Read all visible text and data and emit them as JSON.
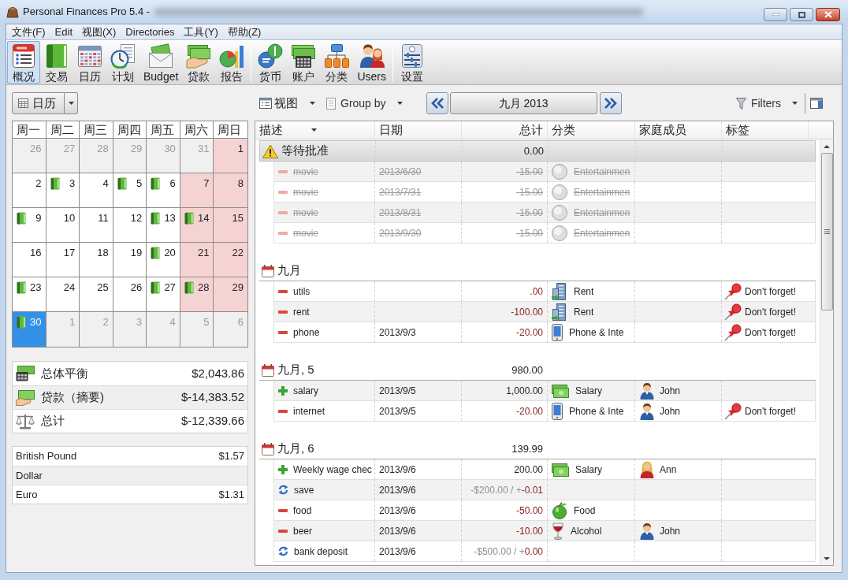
{
  "window": {
    "title": "Personal Finances Pro 5.4 -"
  },
  "menu": [
    "文件(F)",
    "Edit",
    "视图(X)",
    "Directories",
    "工具(Y)",
    "帮助(Z)"
  ],
  "toolbar": {
    "groups": [
      [
        {
          "label": "概况",
          "selected": true
        },
        {
          "label": "交易",
          "selected": false
        },
        {
          "label": "日历",
          "selected": false
        },
        {
          "label": "计划",
          "selected": false
        },
        {
          "label": "Budget",
          "selected": false
        },
        {
          "label": "贷款",
          "selected": false
        },
        {
          "label": "报告",
          "selected": false
        }
      ],
      [
        {
          "label": "货币",
          "selected": false
        },
        {
          "label": "账户",
          "selected": false
        },
        {
          "label": "分类",
          "selected": false
        },
        {
          "label": "Users",
          "selected": false
        }
      ],
      [
        {
          "label": "设置",
          "selected": false
        }
      ]
    ]
  },
  "left": {
    "view_selector": "日历",
    "calendar": {
      "weekdays": [
        "周一",
        "周二",
        "周三",
        "周四",
        "周五",
        "周六",
        "周日"
      ],
      "weeks": [
        [
          {
            "day": "26",
            "other_month": true,
            "has_entry": false,
            "selected": false
          },
          {
            "day": "27",
            "other_month": true,
            "has_entry": false,
            "selected": false
          },
          {
            "day": "28",
            "other_month": true,
            "has_entry": false,
            "selected": false
          },
          {
            "day": "29",
            "other_month": true,
            "has_entry": false,
            "selected": false
          },
          {
            "day": "30",
            "other_month": true,
            "has_entry": false,
            "selected": false
          },
          {
            "day": "31",
            "other_month": true,
            "has_entry": false,
            "selected": false
          },
          {
            "day": "1",
            "other_month": false,
            "has_entry": false,
            "selected": false
          }
        ],
        [
          {
            "day": "2",
            "other_month": false,
            "has_entry": false,
            "selected": false
          },
          {
            "day": "3",
            "other_month": false,
            "has_entry": true,
            "selected": false
          },
          {
            "day": "4",
            "other_month": false,
            "has_entry": false,
            "selected": false
          },
          {
            "day": "5",
            "other_month": false,
            "has_entry": true,
            "selected": false
          },
          {
            "day": "6",
            "other_month": false,
            "has_entry": true,
            "selected": false
          },
          {
            "day": "7",
            "other_month": false,
            "has_entry": false,
            "selected": false
          },
          {
            "day": "8",
            "other_month": false,
            "has_entry": false,
            "selected": false
          }
        ],
        [
          {
            "day": "9",
            "other_month": false,
            "has_entry": true,
            "selected": false
          },
          {
            "day": "10",
            "other_month": false,
            "has_entry": false,
            "selected": false
          },
          {
            "day": "11",
            "other_month": false,
            "has_entry": false,
            "selected": false
          },
          {
            "day": "12",
            "other_month": false,
            "has_entry": false,
            "selected": false
          },
          {
            "day": "13",
            "other_month": false,
            "has_entry": true,
            "selected": false
          },
          {
            "day": "14",
            "other_month": false,
            "has_entry": true,
            "selected": false
          },
          {
            "day": "15",
            "other_month": false,
            "has_entry": false,
            "selected": false
          }
        ],
        [
          {
            "day": "16",
            "other_month": false,
            "has_entry": false,
            "selected": false
          },
          {
            "day": "17",
            "other_month": false,
            "has_entry": false,
            "selected": false
          },
          {
            "day": "18",
            "other_month": false,
            "has_entry": false,
            "selected": false
          },
          {
            "day": "19",
            "other_month": false,
            "has_entry": false,
            "selected": false
          },
          {
            "day": "20",
            "other_month": false,
            "has_entry": true,
            "selected": false
          },
          {
            "day": "21",
            "other_month": false,
            "has_entry": false,
            "selected": false
          },
          {
            "day": "22",
            "other_month": false,
            "has_entry": false,
            "selected": false
          }
        ],
        [
          {
            "day": "23",
            "other_month": false,
            "has_entry": true,
            "selected": false
          },
          {
            "day": "24",
            "other_month": false,
            "has_entry": false,
            "selected": false
          },
          {
            "day": "25",
            "other_month": false,
            "has_entry": false,
            "selected": false
          },
          {
            "day": "26",
            "other_month": false,
            "has_entry": false,
            "selected": false
          },
          {
            "day": "27",
            "other_month": false,
            "has_entry": true,
            "selected": false
          },
          {
            "day": "28",
            "other_month": false,
            "has_entry": true,
            "selected": false
          },
          {
            "day": "29",
            "other_month": false,
            "has_entry": false,
            "selected": false
          }
        ],
        [
          {
            "day": "30",
            "other_month": false,
            "has_entry": true,
            "selected": true
          },
          {
            "day": "1",
            "other_month": true,
            "has_entry": false,
            "selected": false
          },
          {
            "day": "2",
            "other_month": true,
            "has_entry": false,
            "selected": false
          },
          {
            "day": "3",
            "other_month": true,
            "has_entry": false,
            "selected": false
          },
          {
            "day": "4",
            "other_month": true,
            "has_entry": false,
            "selected": false
          },
          {
            "day": "5",
            "other_month": true,
            "has_entry": false,
            "selected": false
          },
          {
            "day": "6",
            "other_month": true,
            "has_entry": false,
            "selected": false
          }
        ]
      ]
    },
    "summary": [
      {
        "kind": "balance",
        "label": "总体平衡",
        "value": "$2,043.86"
      },
      {
        "kind": "loans",
        "label": "贷款（摘要)",
        "value": "$-14,383.52"
      },
      {
        "kind": "total",
        "label": "总计",
        "value": "$-12,339.66"
      }
    ],
    "currencies": [
      {
        "name": "British Pound",
        "rate": "$1.57"
      },
      {
        "name": "Dollar"
      },
      {
        "name": "Euro",
        "rate": "$1.31"
      }
    ]
  },
  "transactions": {
    "view_button": "视图",
    "group_by_button": "Group by",
    "period": "九月 2013",
    "filters_button": "Filters",
    "columns": [
      {
        "label": "描述",
        "sorted": true
      },
      {
        "label": "日期",
        "sorted": false
      },
      {
        "label": "总计",
        "sorted": false
      },
      {
        "label": "分类",
        "sorted": false
      },
      {
        "label": "家庭成员",
        "sorted": false
      },
      {
        "label": "标签",
        "sorted": false
      }
    ],
    "groups": [
      {
        "kind": "pending",
        "title": "等待批准",
        "total": "0.00",
        "rows": [
          {
            "kind": "expense",
            "description": "movie",
            "date": "2013/6/30",
            "total": "-15.00",
            "category": {
              "label": "Entertainmen",
              "kind": "entertainment"
            }
          },
          {
            "kind": "expense",
            "description": "movie",
            "date": "2013/7/31",
            "total": "-15.00",
            "category": {
              "label": "Entertainmen",
              "kind": "entertainment"
            }
          },
          {
            "kind": "expense",
            "description": "movie",
            "date": "2013/8/31",
            "total": "-15.00",
            "category": {
              "label": "Entertainmen",
              "kind": "entertainment"
            }
          },
          {
            "kind": "expense",
            "description": "movie",
            "date": "2013/9/30",
            "total": "-15.00",
            "category": {
              "label": "Entertainmen",
              "kind": "entertainment"
            }
          }
        ]
      },
      {
        "kind": "period",
        "title": "九月",
        "rows": [
          {
            "kind": "expense",
            "description": "utils",
            "total": ".00",
            "category": {
              "label": "Rent",
              "kind": "rent"
            },
            "tag": "Don't forget!"
          },
          {
            "kind": "expense",
            "description": "rent",
            "total": "-100.00",
            "category": {
              "label": "Rent",
              "kind": "rent"
            },
            "tag": "Don't forget!"
          },
          {
            "kind": "expense",
            "description": "phone",
            "date": "2013/9/3",
            "total": "-20.00",
            "category": {
              "label": "Phone & Inte",
              "kind": "phone"
            },
            "tag": "Don't forget!"
          }
        ]
      },
      {
        "kind": "period",
        "title": "九月, 5",
        "total": "980.00",
        "rows": [
          {
            "kind": "income",
            "description": "salary",
            "date": "2013/9/5",
            "total": "1,000.00",
            "category": {
              "label": "Salary",
              "kind": "salary"
            },
            "member": {
              "name": "John",
              "kind": "man"
            }
          },
          {
            "kind": "expense",
            "description": "internet",
            "date": "2013/9/5",
            "total": "-20.00",
            "category": {
              "label": "Phone & Inte",
              "kind": "phone"
            },
            "member": {
              "name": "John",
              "kind": "man"
            },
            "tag": "Don't forget!"
          }
        ]
      },
      {
        "kind": "period",
        "title": "九月, 6",
        "total": "139.99",
        "rows": [
          {
            "kind": "income",
            "description": "Weekly wage chec",
            "date": "2013/9/6",
            "total": "200.00",
            "category": {
              "label": "Salary",
              "kind": "salary"
            },
            "member": {
              "name": "Ann",
              "kind": "woman"
            }
          },
          {
            "kind": "transfer",
            "description": "save",
            "date": "2013/9/6",
            "total": "-$200.00 / +",
            "difference": "-0.01"
          },
          {
            "kind": "expense",
            "description": "food",
            "date": "2013/9/6",
            "total": "-50.00",
            "category": {
              "label": "Food",
              "kind": "food"
            }
          },
          {
            "kind": "expense",
            "description": "beer",
            "date": "2013/9/6",
            "total": "-10.00",
            "category": {
              "label": "Alcohol",
              "kind": "alcohol"
            },
            "member": {
              "name": "John",
              "kind": "man"
            }
          },
          {
            "kind": "transfer",
            "description": "bank deposit",
            "date": "2013/9/6",
            "total": "-$500.00 / +",
            "difference": "0.00"
          }
        ]
      }
    ]
  }
}
